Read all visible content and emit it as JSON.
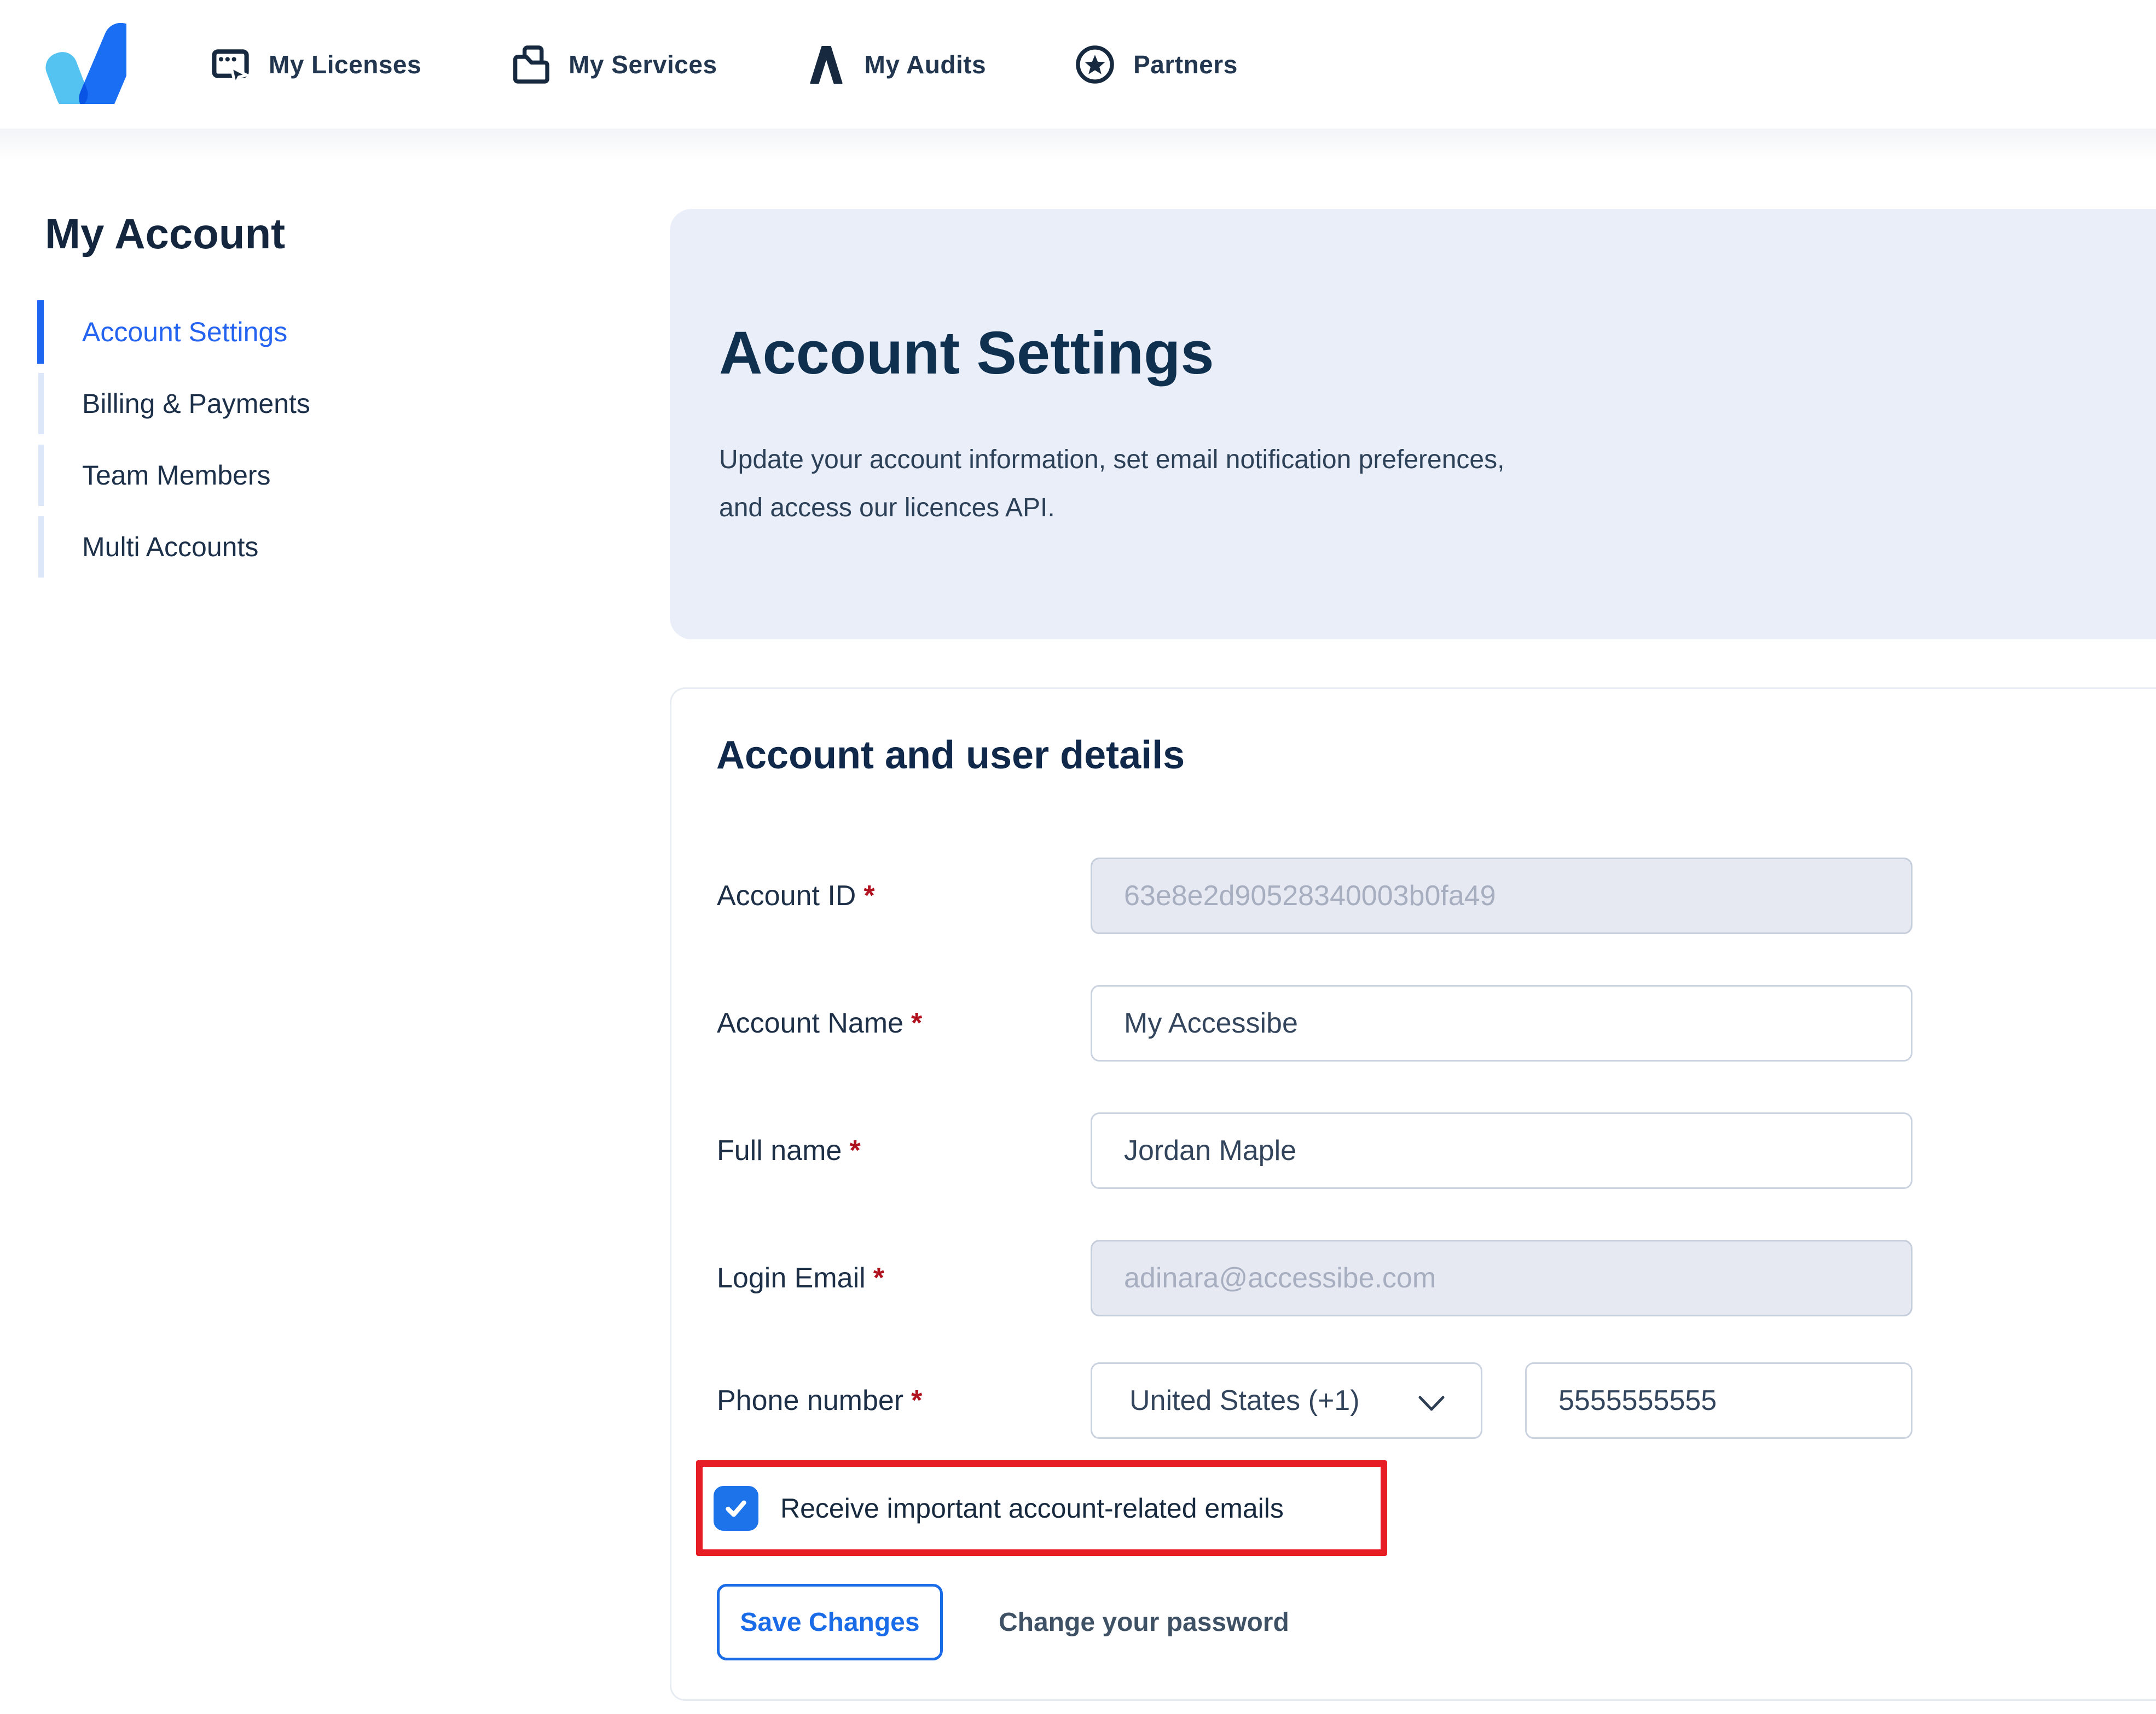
{
  "nav": {
    "items": [
      {
        "label": "My Licenses",
        "icon": "licenses-icon"
      },
      {
        "label": "My Services",
        "icon": "services-icon"
      },
      {
        "label": "My Audits",
        "icon": "audits-icon"
      },
      {
        "label": "Partners",
        "icon": "partners-icon"
      }
    ]
  },
  "sidebar": {
    "title": "My Account",
    "items": [
      {
        "label": "Account Settings",
        "active": true
      },
      {
        "label": "Billing & Payments",
        "active": false
      },
      {
        "label": "Team Members",
        "active": false
      },
      {
        "label": "Multi Accounts",
        "active": false
      }
    ]
  },
  "header": {
    "title": "Account Settings",
    "description_line1": "Update your account information, set email notification preferences,",
    "description_line2": "and access our licences API."
  },
  "form": {
    "section_title": "Account and user details",
    "required_marker": "*",
    "fields": [
      {
        "label": "Account ID",
        "required": true,
        "value": "63e8e2d90528340003b0fa49",
        "disabled": true
      },
      {
        "label": "Account Name",
        "required": true,
        "value": "My Accessibe",
        "disabled": false
      },
      {
        "label": "Full name",
        "required": true,
        "value": "Jordan Maple",
        "disabled": false
      },
      {
        "label": "Login Email",
        "required": true,
        "value": "adinara@accessibe.com",
        "disabled": true
      },
      {
        "label": "Phone number",
        "required": true,
        "country": "United States (+1)",
        "number": "5555555555"
      }
    ],
    "checkbox": {
      "label": "Receive important account-related emails",
      "checked": true
    },
    "buttons": {
      "save": "Save Changes",
      "change_password": "Change your password"
    }
  },
  "colors": {
    "accent_blue": "#1e66f0",
    "active_link_blue": "#2464f1",
    "button_blue": "#1a6be8",
    "checkbox_blue": "#1d73e9",
    "highlight_red": "#e71d25",
    "required_red": "#b0121f",
    "navy_text": "#16293f",
    "hero_card_bg": "#e9eef9",
    "disabled_input_bg": "#e6e9f2",
    "logo_light_blue": "#54c3f1",
    "logo_dark_blue": "#1a6ef3"
  }
}
